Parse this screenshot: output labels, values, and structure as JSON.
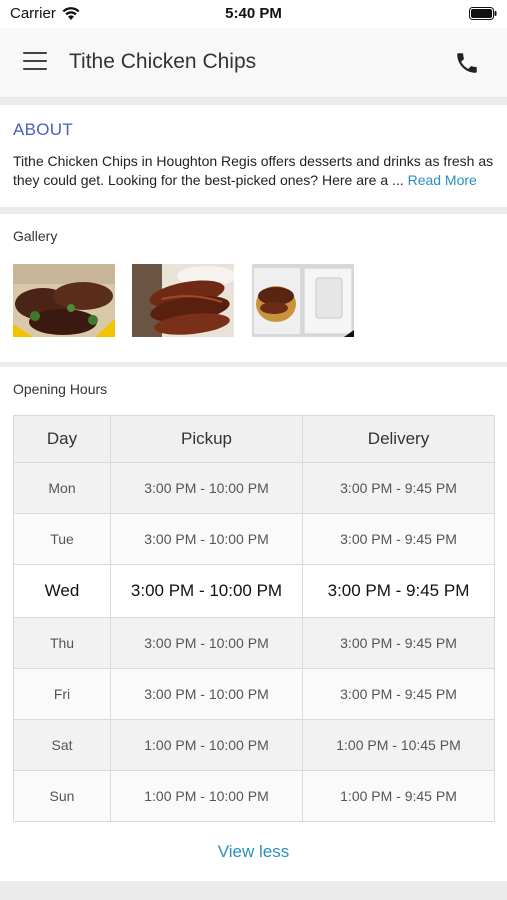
{
  "status_bar": {
    "carrier": "Carrier",
    "time": "5:40 PM"
  },
  "header": {
    "title": "Tithe Chicken Chips",
    "menu_icon": "hamburger-menu-icon",
    "call_icon": "phone-icon"
  },
  "about": {
    "title": "ABOUT",
    "text": "Tithe Chicken Chips in Houghton Regis offers desserts and drinks as fresh as they could get. Looking for the best-picked ones? Here are a ...",
    "read_more": "Read More"
  },
  "gallery": {
    "label": "Gallery",
    "images": [
      {
        "alt": "ribs-platter-photo"
      },
      {
        "alt": "bbq-ribs-photo"
      },
      {
        "alt": "takeaway-box-photo"
      }
    ]
  },
  "opening_hours": {
    "label": "Opening Hours",
    "headers": [
      "Day",
      "Pickup",
      "Delivery"
    ],
    "rows": [
      {
        "day": "Mon",
        "pickup": "3:00 PM - 10:00 PM",
        "delivery": "3:00 PM - 9:45 PM"
      },
      {
        "day": "Tue",
        "pickup": "3:00 PM - 10:00 PM",
        "delivery": "3:00 PM - 9:45 PM"
      },
      {
        "day": "Wed",
        "pickup": "3:00 PM - 10:00 PM",
        "delivery": "3:00 PM - 9:45 PM"
      },
      {
        "day": "Thu",
        "pickup": "3:00 PM - 10:00 PM",
        "delivery": "3:00 PM - 9:45 PM"
      },
      {
        "day": "Fri",
        "pickup": "3:00 PM - 10:00 PM",
        "delivery": "3:00 PM - 9:45 PM"
      },
      {
        "day": "Sat",
        "pickup": "1:00 PM - 10:00 PM",
        "delivery": "1:00 PM - 10:45 PM"
      },
      {
        "day": "Sun",
        "pickup": "1:00 PM - 10:00 PM",
        "delivery": "1:00 PM - 9:45 PM"
      }
    ],
    "view_less": "View less"
  },
  "colors": {
    "accent": "#2a8fc2",
    "about_title": "#4a60b8",
    "background": "#ebebeb"
  }
}
